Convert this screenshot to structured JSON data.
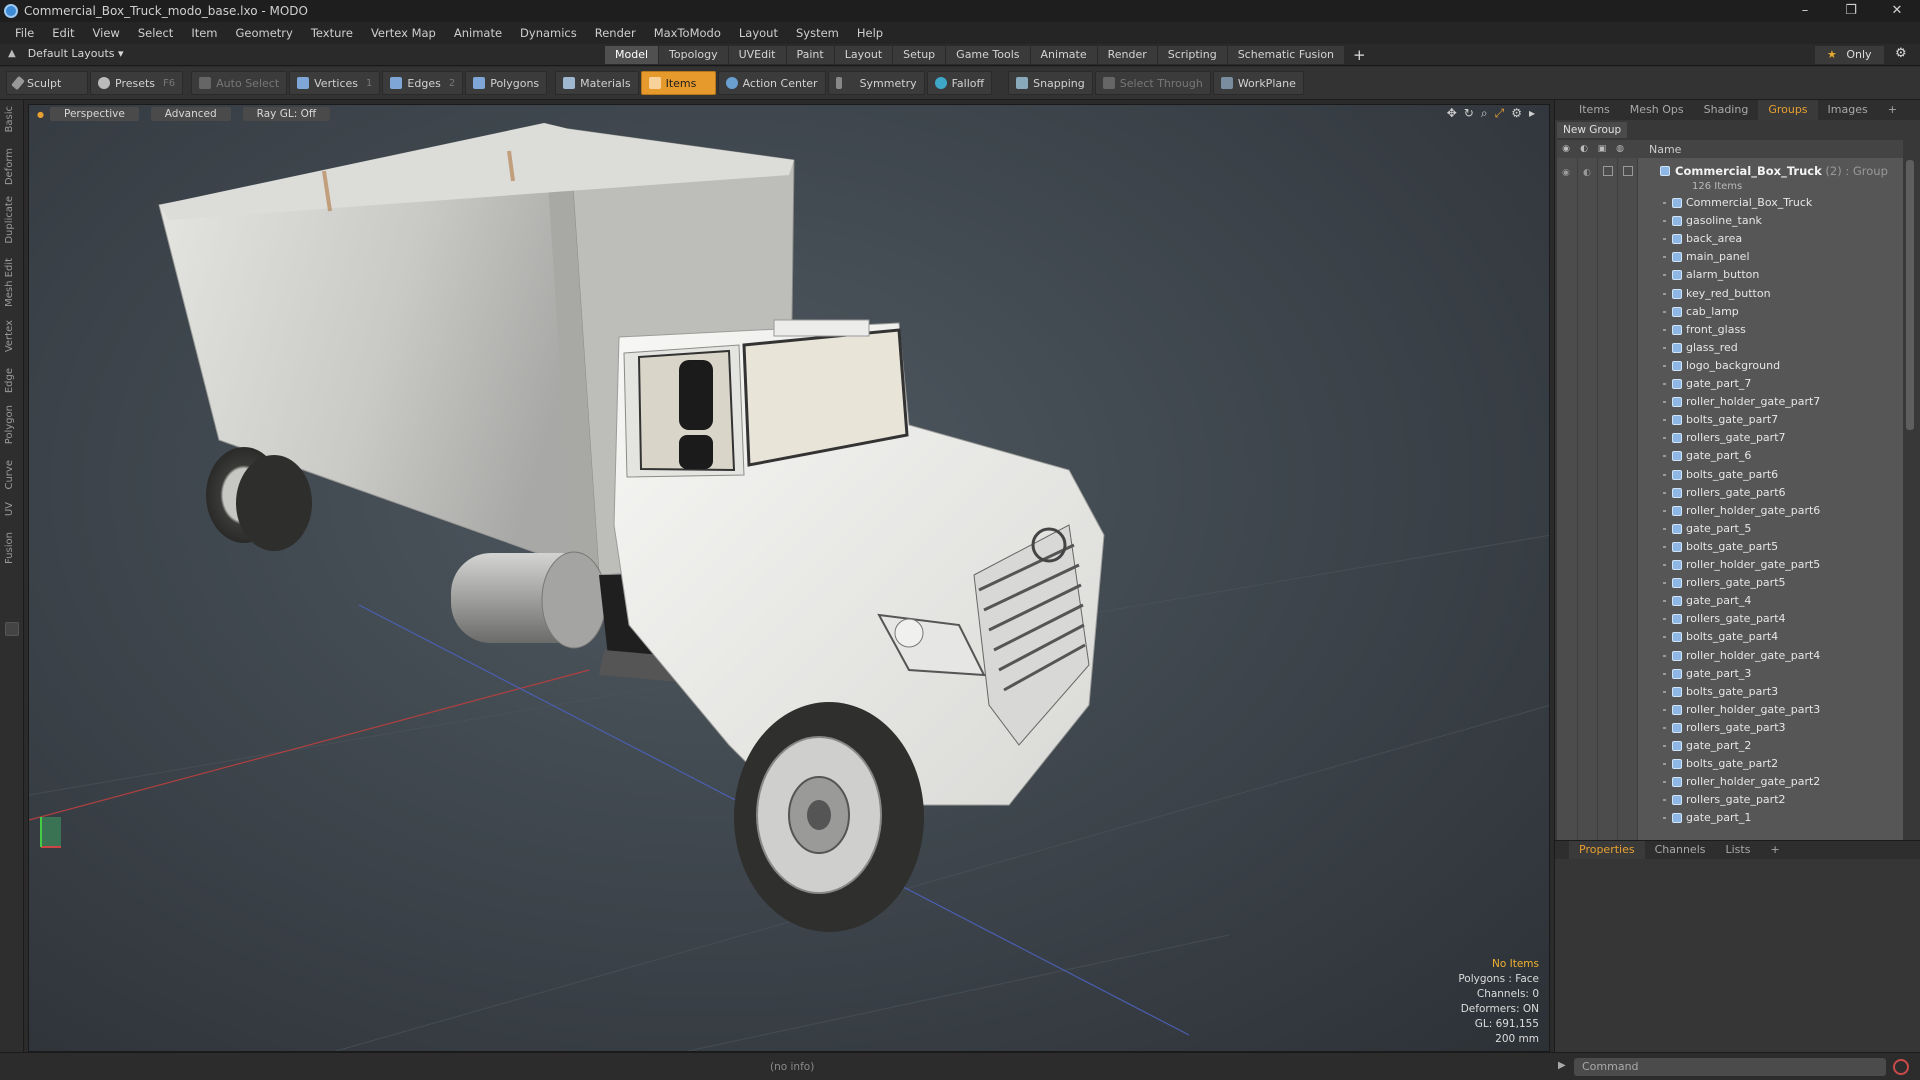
{
  "window": {
    "title": "Commercial_Box_Truck_modo_base.lxo - MODO",
    "controls": [
      "–",
      "❐",
      "✕"
    ]
  },
  "menu": [
    "File",
    "Edit",
    "View",
    "Select",
    "Item",
    "Geometry",
    "Texture",
    "Vertex Map",
    "Animate",
    "Dynamics",
    "Render",
    "MaxToModo",
    "Layout",
    "System",
    "Help"
  ],
  "layouts": {
    "label": "Default Layouts ▾"
  },
  "mode_tabs": [
    "Model",
    "Topology",
    "UVEdit",
    "Paint",
    "Layout",
    "Setup",
    "Game Tools",
    "Animate",
    "Render",
    "Scripting",
    "Schematic Fusion"
  ],
  "mode_active": "Model",
  "only_label": "Only",
  "toolbar": {
    "sculpt": "Sculpt",
    "presets": "Presets",
    "presets_key": "F6",
    "auto_select": "Auto Select",
    "vertices": "Vertices",
    "vertices_key": "1",
    "edges": "Edges",
    "edges_key": "2",
    "polygons": "Polygons",
    "materials": "Materials",
    "items": "Items",
    "action_center": "Action Center",
    "symmetry": "Symmetry",
    "falloff": "Falloff",
    "snapping": "Snapping",
    "select_through": "Select Through",
    "workplane": "WorkPlane"
  },
  "left_tabs": [
    "Basic",
    "Deform",
    "Duplicate",
    "Mesh Edit",
    "Vertex",
    "Edge",
    "Polygon",
    "Curve",
    "UV",
    "Fusion"
  ],
  "viewport": {
    "buttons": [
      "Perspective",
      "Advanced",
      "Ray GL: Off"
    ],
    "stats": {
      "no_items": "No Items",
      "polygons": "Polygons : Face",
      "channels": "Channels: 0",
      "deformers": "Deformers: ON",
      "gl": "GL: 691,155",
      "scale": "200 mm"
    }
  },
  "panel_tabs": [
    "Items",
    "Mesh Ops",
    "Shading",
    "Groups",
    "Images"
  ],
  "panel_active": "Groups",
  "new_group": "New Group",
  "tree": {
    "name_header": "Name",
    "group_name": "Commercial_Box_Truck",
    "group_suffix": " (2) : Group",
    "group_count": "126 Items",
    "items": [
      "Commercial_Box_Truck",
      "gasoline_tank",
      "back_area",
      "main_panel",
      "alarm_button",
      "key_red_button",
      "cab_lamp",
      "front_glass",
      "glass_red",
      "logo_background",
      "gate_part_7",
      "roller_holder_gate_part7",
      "bolts_gate_part7",
      "rollers_gate_part7",
      "gate_part_6",
      "bolts_gate_part6",
      "rollers_gate_part6",
      "roller_holder_gate_part6",
      "gate_part_5",
      "bolts_gate_part5",
      "roller_holder_gate_part5",
      "rollers_gate_part5",
      "gate_part_4",
      "rollers_gate_part4",
      "bolts_gate_part4",
      "roller_holder_gate_part4",
      "gate_part_3",
      "bolts_gate_part3",
      "roller_holder_gate_part3",
      "rollers_gate_part3",
      "gate_part_2",
      "bolts_gate_part2",
      "roller_holder_gate_part2",
      "rollers_gate_part2",
      "gate_part_1"
    ]
  },
  "lower_tabs": [
    "Properties",
    "Channels",
    "Lists"
  ],
  "lower_active": "Properties",
  "status": {
    "info": "(no info)",
    "command_placeholder": "Command"
  },
  "colors": {
    "accent": "#e69a2b",
    "tab_active": "#e8a030",
    "truck_body": "#f2f2ef",
    "box": "#cfcfcc"
  }
}
